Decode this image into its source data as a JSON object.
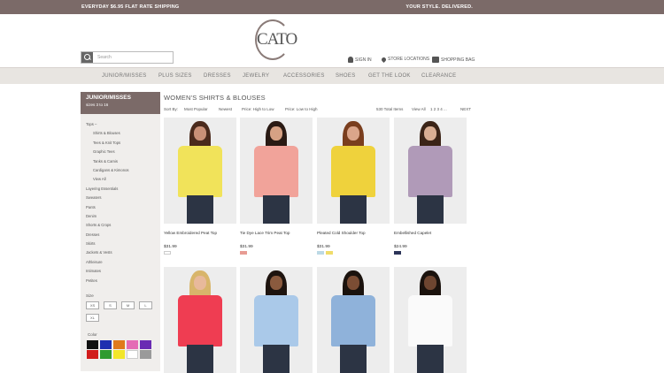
{
  "promo": {
    "left": "EVERYDAY $6.95 FLAT RATE SHIPPING",
    "right": "YOUR STYLE. DELIVERED."
  },
  "logo": {
    "text": "CATO"
  },
  "search": {
    "placeholder": "Search"
  },
  "utility": {
    "signin": "SIGN IN",
    "stores": "STORE LOCATIONS",
    "bag": "SHOPPING BAG"
  },
  "nav": [
    "JUNIOR/MISSES",
    "PLUS SIZES",
    "DRESSES",
    "JEWELRY",
    "ACCESSORIES",
    "SHOES",
    "GET THE LOOK",
    "CLEARANCE"
  ],
  "sidebar": {
    "title": "JUNIOR/MISSES",
    "subtitle": "sizes 3 to 16",
    "categories": [
      {
        "label": "Tops –",
        "sub": false
      },
      {
        "label": "Shirts & Blouses",
        "sub": true
      },
      {
        "label": "Tees & Knit Tops",
        "sub": true
      },
      {
        "label": "Graphic Tees",
        "sub": true
      },
      {
        "label": "Tanks & Camis",
        "sub": true
      },
      {
        "label": "Cardigans & Kimonos",
        "sub": true
      },
      {
        "label": "View All",
        "sub": true
      },
      {
        "label": "Layering Essentials",
        "sub": false
      },
      {
        "label": "Sweaters",
        "sub": false
      },
      {
        "label": "Pants",
        "sub": false
      },
      {
        "label": "Denim",
        "sub": false
      },
      {
        "label": "Shorts & Crops",
        "sub": false
      },
      {
        "label": "Dresses",
        "sub": false
      },
      {
        "label": "Skirts",
        "sub": false
      },
      {
        "label": "Jackets & Vests",
        "sub": false
      },
      {
        "label": "Athleisure",
        "sub": false
      },
      {
        "label": "Intimates",
        "sub": false
      },
      {
        "label": "Petites",
        "sub": false
      }
    ],
    "size_label": "Size",
    "sizes": [
      "XS",
      "S",
      "M",
      "L",
      "XL"
    ],
    "color_label": "Color",
    "colors": [
      "#111111",
      "#1f2fb0",
      "#e07a1c",
      "#e46bb5",
      "#6a2bb3",
      "#d11c1c",
      "#2f9b2f",
      "#f2e62a",
      "#ffffff",
      "#9a9a9a"
    ]
  },
  "page": {
    "heading": "WOMEN'S SHIRTS & BLOUSES"
  },
  "sort": {
    "label": "Sort By:",
    "options": [
      "Most Popular",
      "Newest",
      "Price: High to Low",
      "Price: Low to High"
    ],
    "total": "530 Total Items",
    "view_all": "View All",
    "pages": "1 2 3 4 ...",
    "next": "NEXT"
  },
  "products": [
    {
      "name": "Yellow Embroidered Peat Top",
      "price": "$31.99",
      "swatches": [
        "#ffffff"
      ],
      "colors": {
        "top": "#f1e35a",
        "hair": "#4a2a1c",
        "skin": "#c99077"
      }
    },
    {
      "name": "Tie Dye Lace Trim Peat Top",
      "price": "$31.99",
      "swatches": [
        "#e79b93"
      ],
      "colors": {
        "top": "#f1a39a",
        "hair": "#2a1a14",
        "skin": "#d6a184"
      }
    },
    {
      "name": "Pleated Cold Shoulder Top",
      "price": "$31.99",
      "swatches": [
        "#bcd9e5",
        "#f0dc6a"
      ],
      "colors": {
        "top": "#efd23c",
        "hair": "#7a3e1e",
        "skin": "#dba58a"
      }
    },
    {
      "name": "Embellished Capelet",
      "price": "$24.99",
      "swatches": [
        "#2c3458"
      ],
      "colors": {
        "top": "#b09ab8",
        "hair": "#3b2417",
        "skin": "#d9ae93"
      }
    },
    {
      "name": "",
      "price": "",
      "swatches": [],
      "colors": {
        "top": "#ef3d52",
        "hair": "#d8b56b",
        "skin": "#e8b99b"
      }
    },
    {
      "name": "",
      "price": "",
      "swatches": [],
      "colors": {
        "top": "#aac9e9",
        "hair": "#1e140f",
        "skin": "#8a5a3e"
      }
    },
    {
      "name": "",
      "price": "",
      "swatches": [],
      "colors": {
        "top": "#8fb2da",
        "hair": "#1a120d",
        "skin": "#7b4d34"
      }
    },
    {
      "name": "",
      "price": "",
      "swatches": [],
      "colors": {
        "top": "#fafafa",
        "hair": "#1b120d",
        "skin": "#6e4530"
      }
    }
  ]
}
